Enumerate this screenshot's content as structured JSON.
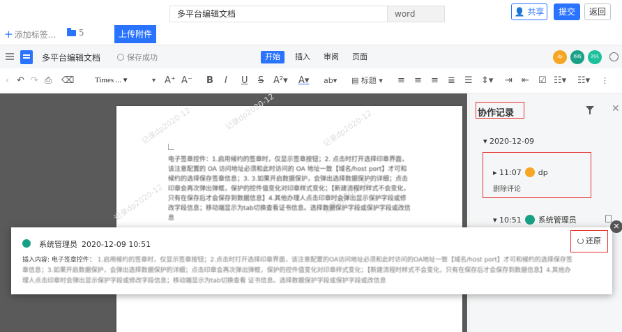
{
  "header": {
    "doc_title": "多平台编辑文档",
    "doc_type": "word",
    "share_label": "共享",
    "submit_label": "提交",
    "back_label": "返回"
  },
  "tagbar": {
    "add_tag": "添加标签...",
    "folder_count": "5",
    "upload_label": "上传附件"
  },
  "editor": {
    "doc_name": "多平台编辑文档",
    "save_status": "保存成功",
    "tabs": [
      "开始",
      "插入",
      "审阅",
      "页面"
    ],
    "avatars": [
      {
        "text": "dp",
        "color": "#f5a623"
      },
      {
        "text": "系统",
        "color": "#17a085"
      },
      {
        "text": "刘光",
        "color": "#1bbf9a"
      }
    ]
  },
  "toolbar": {
    "font": "Times ...",
    "heading": "标题"
  },
  "page": {
    "watermark": "记录dp2020-12",
    "body": "电子签章控件：1.启用候约的签章时，仅显示签章按钮；2. 点击时打开选择印章界面，该注意配置的 OA 访问地址必须和此时访问的 OA 地址一致【域名/host port】才可和候约的选择保存签章信息；3. 3.如果开启数据保护，会弹出选择数据保护的详细；点击印章会再次弹出弹框，保护的控件值变化对印章样式变化；【新建流程时样式不会变化，只有在保存后才会保存到数据信息】4.其他办理人点击印章时会弹出显示保护字段或修改字段信息；移动端显示为tab切换查看证书信息。选择数据保护字段或保护字段或改信息"
  },
  "panel": {
    "title": "协作记录",
    "date": "2020-12-09",
    "record1": {
      "time": "11:07",
      "user": "dp",
      "action": "删除评论"
    },
    "record2": {
      "time": "10:51",
      "user": "系统管理员"
    }
  },
  "popup": {
    "user": "系统管理员",
    "timestamp": "2020-12-09 10:51",
    "label": "插入内容: 电子签章控件：",
    "content": "1.启用候约的签章时，仅显示签章按钮；2.点击时打开选择印章界面，该注意配置的OA访问地址必须和此时访问的OA地址一致【域名/host port】才可和候约的选择保存签章信息；3.如果开启数据保护，会弹出选择数据保护的详细；点击印章会再次弹出弹框，保护的控件值变化对印章样式变化；【新建流程时样式不会变化，只有在保存后才会保存到数据信息】4.其他办理人点击印章时会弹出显示保护字段或修改字段信息；移动端显示为tab切换查看 证书信息。选择数据保护字段或保护字段或改信息",
    "restore_label": "还原"
  }
}
